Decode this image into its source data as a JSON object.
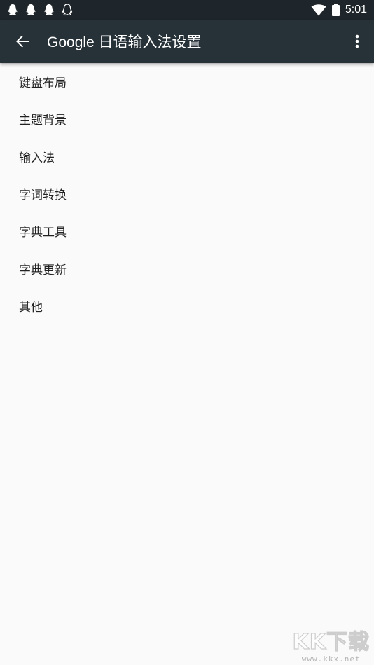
{
  "status_bar": {
    "notification_icons": [
      "qq-icon",
      "qq-icon",
      "qq-icon",
      "qq-outline-icon"
    ],
    "time": "5:01"
  },
  "app_bar": {
    "title": "Google 日语输入法设置",
    "bg_color": "#263238"
  },
  "settings_list": {
    "items": [
      {
        "label": "键盘布局"
      },
      {
        "label": "主题背景"
      },
      {
        "label": "输入法"
      },
      {
        "label": "字词转换"
      },
      {
        "label": "字典工具"
      },
      {
        "label": "字典更新"
      },
      {
        "label": "其他"
      }
    ]
  },
  "watermark": {
    "logo_text": "KK下载",
    "url": "www.kkx.net"
  }
}
